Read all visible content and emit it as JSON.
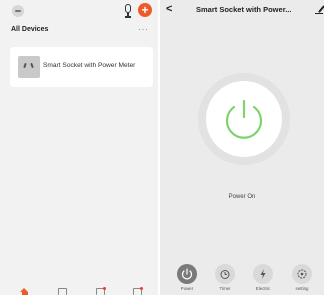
{
  "left": {
    "section_title": "All Devices",
    "more": "···",
    "add_symbol": "+",
    "devices": [
      {
        "name": "Smart Socket with Power Meter"
      }
    ],
    "accent_color": "#ee5a2a"
  },
  "right": {
    "back": "<",
    "title": "Smart Socket with Power...",
    "status": "Power On",
    "power_color": "#7ed36b",
    "controls": [
      {
        "label": "Power",
        "icon": "power-icon"
      },
      {
        "label": "Timer",
        "icon": "timer-icon"
      },
      {
        "label": "Electric",
        "icon": "electric-icon"
      },
      {
        "label": "setting",
        "icon": "setting-icon"
      }
    ]
  }
}
